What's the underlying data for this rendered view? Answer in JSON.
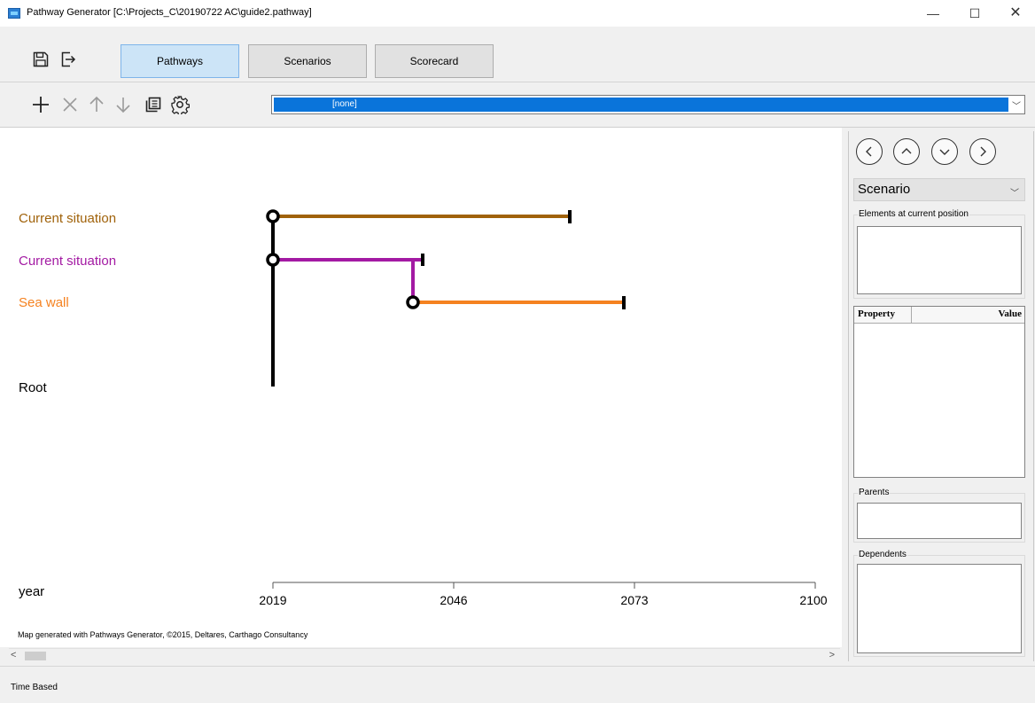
{
  "window": {
    "title": "Pathway Generator [C:\\Projects_C\\20190722 AC\\guide2.pathway]",
    "controls": {
      "minimize": "—",
      "maximize": "☐",
      "close": "✕"
    }
  },
  "tabs": [
    {
      "label": "Pathways",
      "active": true
    },
    {
      "label": "Scenarios",
      "active": false
    },
    {
      "label": "Scorecard",
      "active": false
    }
  ],
  "toolbar": {
    "icons": [
      "save-icon",
      "export-icon",
      "add-icon",
      "delete-icon",
      "move-up-icon",
      "move-down-icon",
      "copy-icon",
      "settings-icon"
    ],
    "selection": "[none]"
  },
  "map": {
    "rows": [
      {
        "label": "Current situation",
        "color": "#a0620a",
        "start": 2019,
        "end": 2068
      },
      {
        "label": "Current situation",
        "color": "#a31aa3",
        "start": 2019,
        "end": 2043
      },
      {
        "label": "Sea wall",
        "color": "#f58220",
        "start": 2042,
        "end": 2077
      },
      {
        "label": "Root",
        "color": "#000000"
      }
    ],
    "axis": {
      "label": "year",
      "ticks": [
        "2019",
        "2046",
        "2073",
        "2100"
      ],
      "min": 2019,
      "max": 2100
    },
    "credit": "Map generated with Pathways Generator, ©2015, Deltares, Carthago Consultancy"
  },
  "side_panel": {
    "nav_icons": [
      "left-circle-icon",
      "up-circle-icon",
      "down-circle-icon",
      "right-circle-icon"
    ],
    "scenario_select": "Scenario",
    "elements_group": "Elements at current position",
    "property_header": "Property",
    "value_header": "Value",
    "parents_group": "Parents",
    "dependents_group": "Dependents"
  },
  "status": {
    "mode": "Time Based"
  }
}
